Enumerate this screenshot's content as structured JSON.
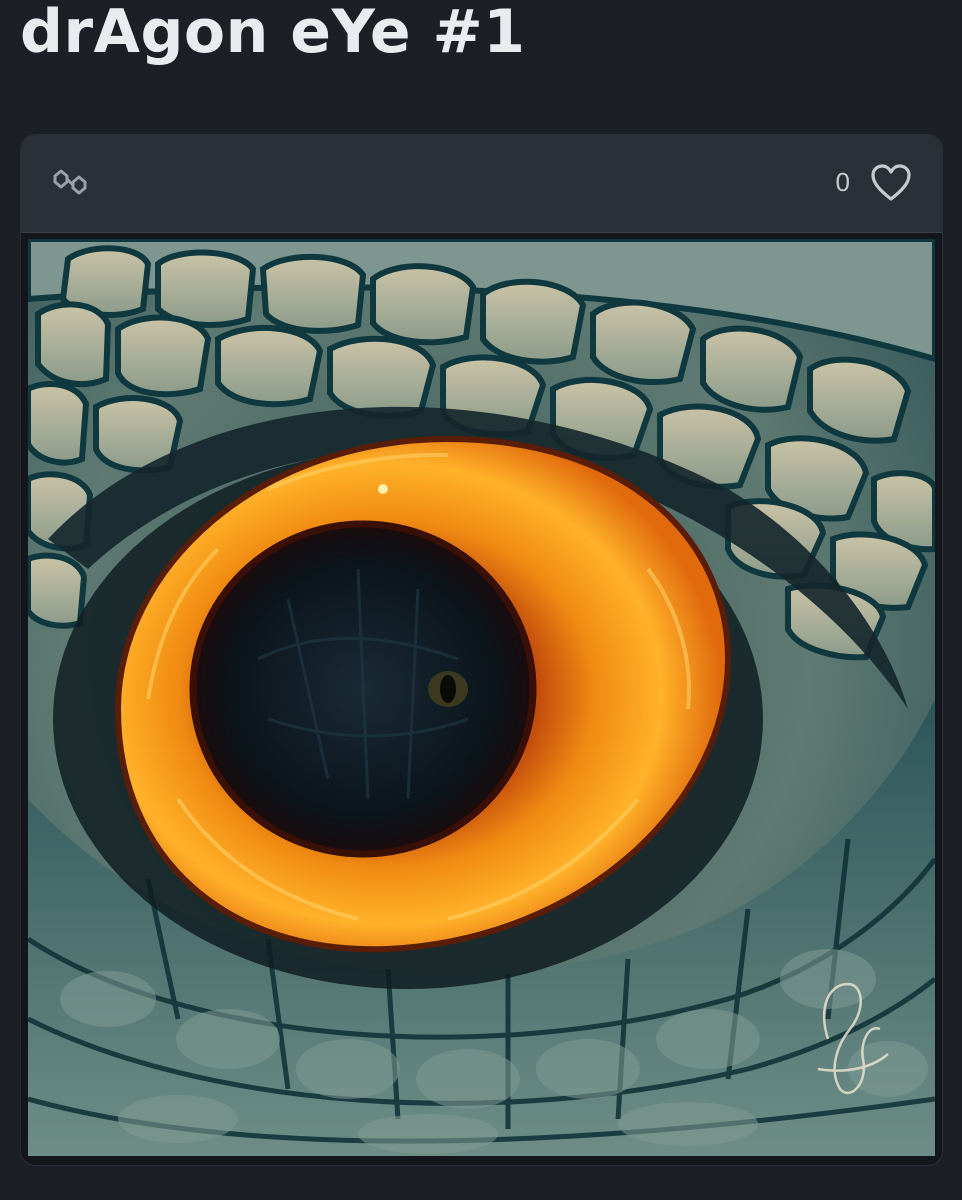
{
  "title": "drAgon eYe #1",
  "card": {
    "chain_icon": "polygon-chain-icon",
    "like_count": "0",
    "like_icon": "heart-outline-icon"
  },
  "artwork": {
    "subject": "dragon-eye-painting",
    "colors": {
      "iris_outer": "#f7a21b",
      "iris_inner": "#c2410c",
      "pupil": "#0a1218",
      "scales": "#8a9a8c",
      "scale_lines": "#123c45",
      "skin_dark": "#1f3a3f"
    }
  },
  "colors": {
    "background": "#1c1f25",
    "card_header": "#2b2f37",
    "title_text": "#e9ebef"
  }
}
